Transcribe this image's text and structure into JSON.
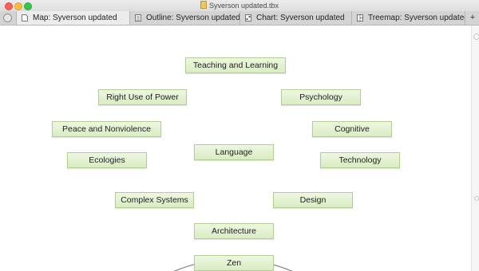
{
  "window": {
    "title": "Syverson updated.tbx",
    "close_icon": "close-traffic-light",
    "minimize_icon": "minimize-traffic-light",
    "zoom_icon": "zoom-traffic-light"
  },
  "tabs": [
    {
      "label": "Map: Syverson updated",
      "icon": "map-icon",
      "active": true
    },
    {
      "label": "Outline: Syverson updated",
      "icon": "outline-icon",
      "active": false
    },
    {
      "label": "Chart: Syverson updated",
      "icon": "chart-icon",
      "active": false
    },
    {
      "label": "Treemap: Syverson updated",
      "icon": "treemap-icon",
      "active": false
    }
  ],
  "add_tab_label": "+",
  "map": {
    "node_color": "#dcedc8",
    "node_border": "#b6cc97",
    "nodes": [
      {
        "label": "Teaching and Learning"
      },
      {
        "label": "Right Use of Power"
      },
      {
        "label": "Psychology"
      },
      {
        "label": "Peace and Nonviolence"
      },
      {
        "label": "Cognitive"
      },
      {
        "label": "Language"
      },
      {
        "label": "Ecologies"
      },
      {
        "label": "Technology"
      },
      {
        "label": "Complex Systems"
      },
      {
        "label": "Design"
      },
      {
        "label": "Architecture"
      },
      {
        "label": "Zen"
      }
    ]
  }
}
